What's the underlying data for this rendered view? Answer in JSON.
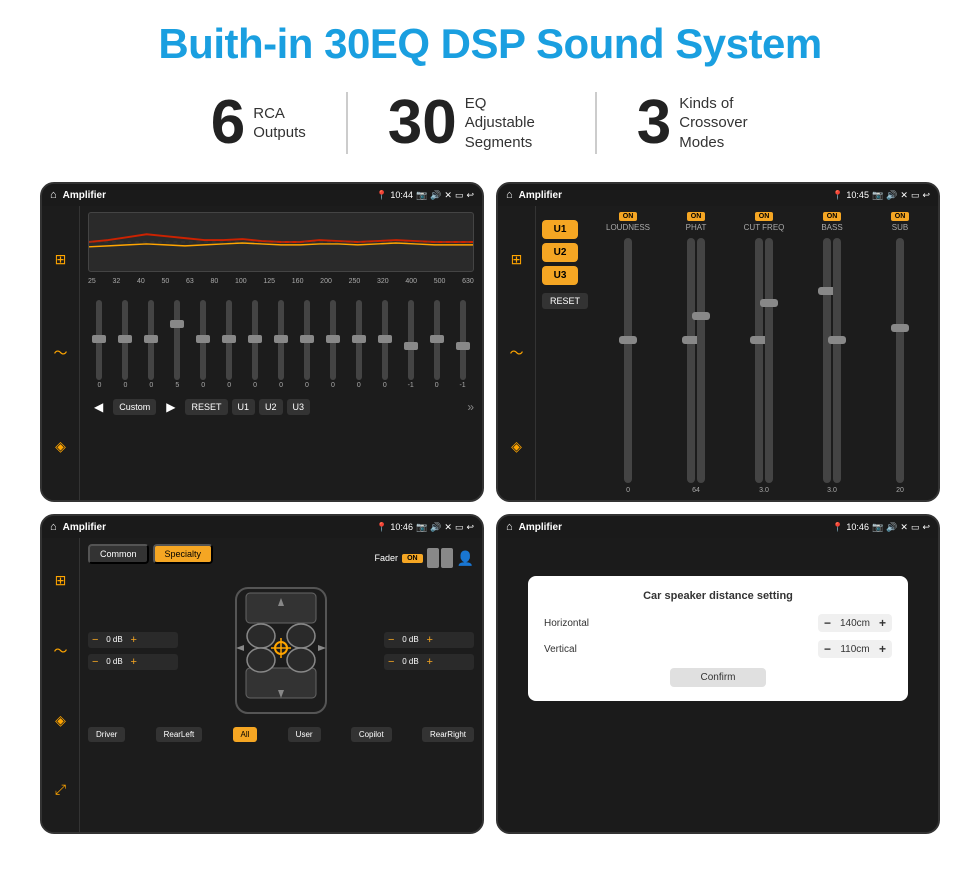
{
  "page": {
    "title": "Buith-in 30EQ DSP Sound System",
    "stats": [
      {
        "number": "6",
        "label": "RCA\nOutputs"
      },
      {
        "number": "30",
        "label": "EQ Adjustable\nSegments"
      },
      {
        "number": "3",
        "label": "Kinds of\nCrossover Modes"
      }
    ],
    "screens": [
      {
        "id": "eq-screen",
        "topbar": {
          "time": "10:44",
          "title": "Amplifier"
        },
        "type": "equalizer"
      },
      {
        "id": "crossover-screen",
        "topbar": {
          "time": "10:45",
          "title": "Amplifier"
        },
        "type": "crossover"
      },
      {
        "id": "fader-screen",
        "topbar": {
          "time": "10:46",
          "title": "Amplifier"
        },
        "type": "fader"
      },
      {
        "id": "distance-screen",
        "topbar": {
          "time": "10:46",
          "title": "Amplifier"
        },
        "type": "distance",
        "dialog": {
          "title": "Car speaker distance setting",
          "horizontal_label": "Horizontal",
          "horizontal_value": "140cm",
          "vertical_label": "Vertical",
          "vertical_value": "110cm",
          "confirm_label": "Confirm"
        }
      }
    ],
    "eq": {
      "freqs": [
        "25",
        "32",
        "40",
        "50",
        "63",
        "80",
        "100",
        "125",
        "160",
        "200",
        "250",
        "320",
        "400",
        "500",
        "630"
      ],
      "values": [
        "0",
        "0",
        "0",
        "5",
        "0",
        "0",
        "0",
        "0",
        "0",
        "0",
        "0",
        "0",
        "-1",
        "0",
        "-1"
      ],
      "presets": [
        "Custom",
        "RESET",
        "U1",
        "U2",
        "U3"
      ]
    },
    "crossover": {
      "u_buttons": [
        "U1",
        "U2",
        "U3"
      ],
      "controls": [
        "LOUDNESS",
        "PHAT",
        "CUT FREQ",
        "BASS",
        "SUB"
      ],
      "reset_label": "RESET"
    },
    "fader": {
      "tabs": [
        "Common",
        "Specialty"
      ],
      "active_tab": "Specialty",
      "fader_label": "Fader",
      "on_label": "ON",
      "db_values": [
        "0 dB",
        "0 dB",
        "0 dB",
        "0 dB"
      ],
      "bottom_buttons": [
        "Driver",
        "RearLeft",
        "All",
        "User",
        "Copilot",
        "RearRight"
      ]
    },
    "distance_dialog": {
      "title": "Car speaker distance setting",
      "horizontal_label": "Horizontal",
      "horizontal_value": "140cm",
      "vertical_label": "Vertical",
      "vertical_value": "110cm",
      "confirm_label": "Confirm"
    }
  }
}
